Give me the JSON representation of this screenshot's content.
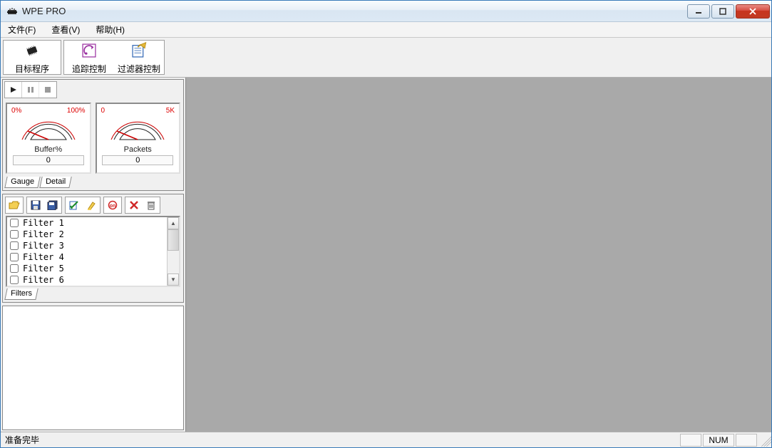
{
  "title": "WPE PRO",
  "menu": {
    "file": "文件(F)",
    "view": "查看(V)",
    "help": "帮助(H)"
  },
  "toolbar": {
    "target_program": "目标程序",
    "trace_control": "追踪控制",
    "filter_control": "过滤器控制"
  },
  "gauges": {
    "buffer": {
      "left": "0%",
      "right": "100%",
      "label": "Buffer%",
      "value": "0"
    },
    "packets": {
      "left": "0",
      "right": "5K",
      "label": "Packets",
      "value": "0"
    }
  },
  "gauge_tabs": {
    "gauge": "Gauge",
    "detail": "Detail"
  },
  "filters_tab": "Filters",
  "filters": [
    "Filter 1",
    "Filter 2",
    "Filter 3",
    "Filter 4",
    "Filter 5",
    "Filter 6"
  ],
  "status": {
    "ready": "准备完毕",
    "num": "NUM"
  }
}
